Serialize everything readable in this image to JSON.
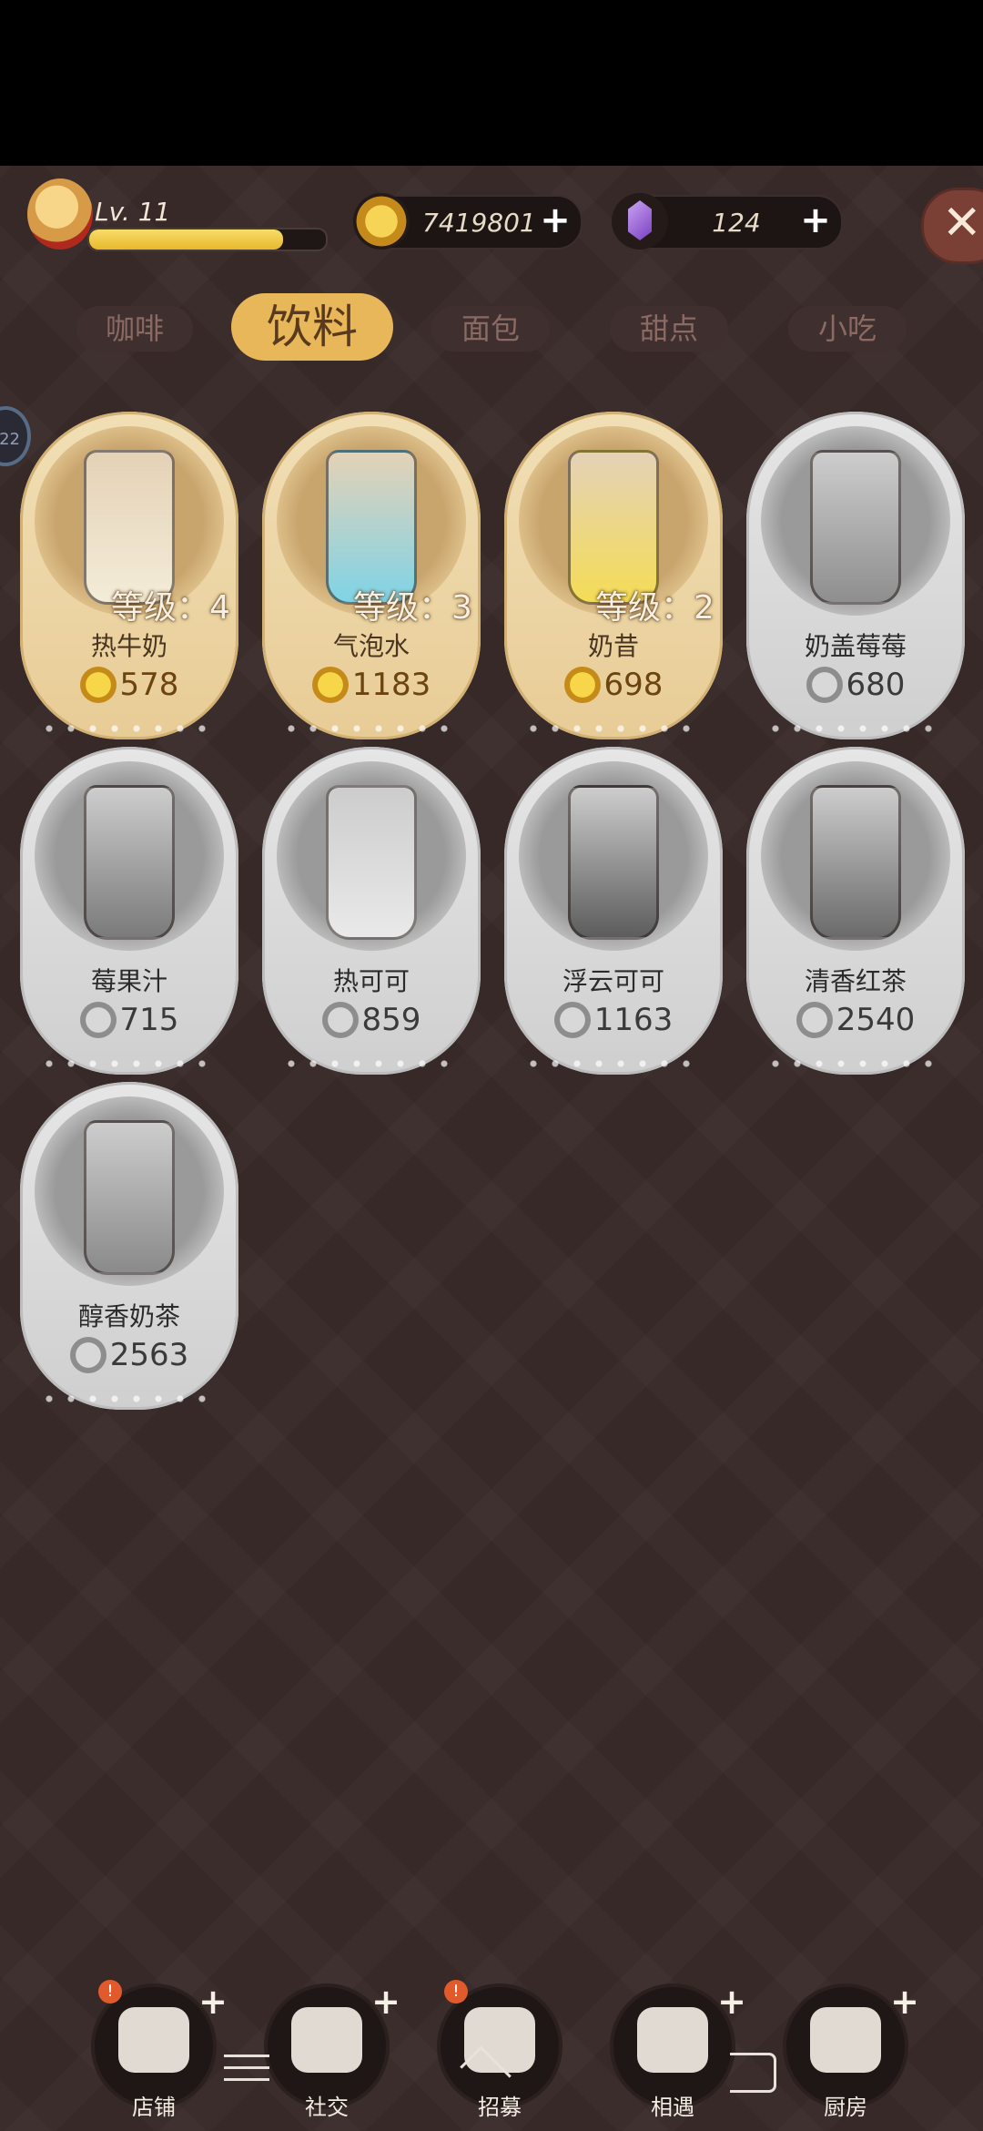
{
  "player": {
    "level_text": "Lv. 11",
    "xp_progress": 0.82
  },
  "currencies": [
    {
      "name": "coins",
      "value": "7419801",
      "icon": "cat-coin-icon"
    },
    {
      "name": "gems",
      "value": "124",
      "icon": "purple-gem-icon"
    }
  ],
  "plus_symbol": "+",
  "close_symbol": "✕",
  "tabs": [
    {
      "label": "咖啡",
      "active": false
    },
    {
      "label": "饮料",
      "active": true
    },
    {
      "label": "面包",
      "active": false
    },
    {
      "label": "甜点",
      "active": false
    },
    {
      "label": "小吃",
      "active": false
    }
  ],
  "side_badge": "22",
  "items": [
    {
      "name": "热牛奶",
      "price": "578",
      "level": "等级：4",
      "unlocked": true,
      "color": "#f3ecd8"
    },
    {
      "name": "气泡水",
      "price": "1183",
      "level": "等级：3",
      "unlocked": true,
      "color": "#7fd3e6"
    },
    {
      "name": "奶昔",
      "price": "698",
      "level": "等级：2",
      "unlocked": true,
      "color": "#f4dc56"
    },
    {
      "name": "奶盖莓莓",
      "price": "680",
      "level": "",
      "unlocked": false,
      "color": "#8e8e8e"
    },
    {
      "name": "莓果汁",
      "price": "715",
      "level": "",
      "unlocked": false,
      "color": "#7a7a7a"
    },
    {
      "name": "热可可",
      "price": "859",
      "level": "",
      "unlocked": false,
      "color": "#e9e9e9"
    },
    {
      "name": "浮云可可",
      "price": "1163",
      "level": "",
      "unlocked": false,
      "color": "#5c5c5c"
    },
    {
      "name": "清香红茶",
      "price": "2540",
      "level": "",
      "unlocked": false,
      "color": "#6a6a6a"
    },
    {
      "name": "醇香奶茶",
      "price": "2563",
      "level": "",
      "unlocked": false,
      "color": "#8a8a8a"
    }
  ],
  "nav": [
    {
      "label": "店铺",
      "alert": "!",
      "icon": "shop-icon"
    },
    {
      "label": "社交",
      "alert": "",
      "icon": "coffee-cup-icon"
    },
    {
      "label": "招募",
      "alert": "!",
      "icon": "recruit-card-icon"
    },
    {
      "label": "相遇",
      "alert": "",
      "icon": "handshake-icon"
    },
    {
      "label": "厨房",
      "alert": "",
      "icon": "cooking-pot-icon"
    }
  ]
}
